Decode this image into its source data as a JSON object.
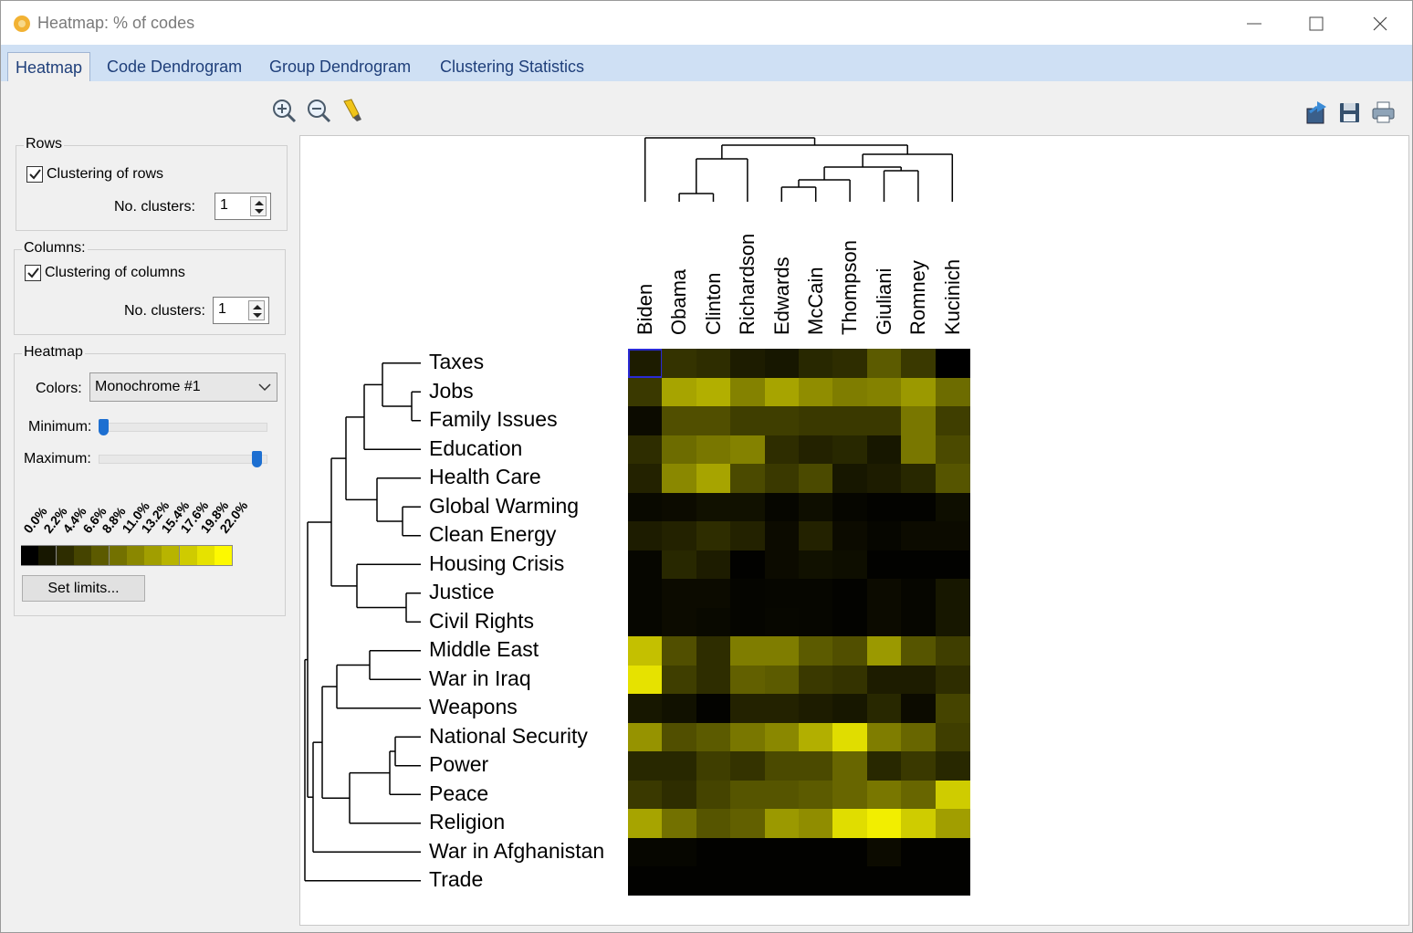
{
  "window": {
    "title": "Heatmap: % of codes",
    "icons": {
      "app": "app-logo-icon",
      "minimize": "minimize-icon",
      "maximize": "maximize-icon",
      "close": "close-icon"
    }
  },
  "tabs": [
    {
      "label": "Heatmap",
      "active": true
    },
    {
      "label": "Code Dendrogram",
      "active": false
    },
    {
      "label": "Group Dendrogram",
      "active": false
    },
    {
      "label": "Clustering Statistics",
      "active": false
    }
  ],
  "toolbar": {
    "left": [
      "zoom-in-icon",
      "zoom-out-icon",
      "highlighter-icon"
    ],
    "right": [
      "export-icon",
      "save-icon",
      "print-icon"
    ]
  },
  "rows_group": {
    "title": "Rows",
    "checkbox_label": "Clustering of rows",
    "checked": true,
    "clusters_label": "No. clusters:",
    "clusters_value": "1"
  },
  "columns_group": {
    "title": "Columns:",
    "checkbox_label": "Clustering of columns",
    "checked": true,
    "clusters_label": "No. clusters:",
    "clusters_value": "1"
  },
  "heatmap_group": {
    "title": "Heatmap",
    "colors_label": "Colors:",
    "colors_value": "Monochrome #1",
    "minimum_label": "Minimum:",
    "minimum_value": 0.0,
    "maximum_label": "Maximum:",
    "maximum_value": 1.0,
    "legend_labels": [
      "0.0%",
      "2.2%",
      "4.4%",
      "6.6%",
      "8.8%",
      "11.0%",
      "13.2%",
      "15.4%",
      "17.6%",
      "19.8%",
      "22.0%"
    ],
    "legend_colors": [
      "#000000",
      "#171700",
      "#2e2d00",
      "#454400",
      "#5c5a00",
      "#737100",
      "#8a8700",
      "#a19e00",
      "#b8b400",
      "#cfcb00",
      "#e6e200",
      "#fdf900"
    ],
    "set_limits_label": "Set limits..."
  },
  "chart_data": {
    "type": "heatmap",
    "columns": [
      "Biden",
      "Obama",
      "Clinton",
      "Richardson",
      "Edwards",
      "McCain",
      "Thompson",
      "Giuliani",
      "Romney",
      "Kucinich"
    ],
    "rows": [
      "Taxes",
      "Jobs",
      "Family Issues",
      "Education",
      "Health Care",
      "Global Warming",
      "Clean Energy",
      "Housing Crisis",
      "Justice",
      "Civil Rights",
      "Middle East",
      "War in Iraq",
      "Weapons",
      "National Security",
      "Power",
      "Peace",
      "Religion",
      "War in Afghanistan",
      "Trade"
    ],
    "scale_min_pct": 0.0,
    "scale_max_pct": 22.0,
    "values_pct": [
      [
        2.5,
        4.5,
        4.0,
        2.5,
        2.0,
        3.5,
        4.0,
        8.0,
        5.0,
        0.0
      ],
      [
        5.0,
        14.5,
        15.5,
        11.5,
        14.5,
        12.5,
        11.0,
        11.5,
        13.5,
        9.5
      ],
      [
        1.0,
        7.0,
        7.0,
        5.5,
        5.5,
        5.0,
        5.0,
        5.0,
        10.5,
        5.5
      ],
      [
        4.0,
        9.5,
        10.5,
        11.5,
        4.0,
        3.0,
        3.5,
        2.0,
        10.5,
        6.5
      ],
      [
        3.0,
        12.0,
        14.5,
        6.5,
        5.0,
        6.5,
        2.0,
        2.5,
        3.5,
        7.5
      ],
      [
        0.8,
        1.0,
        1.5,
        1.5,
        0.5,
        1.2,
        0.5,
        0.3,
        0.3,
        1.2
      ],
      [
        2.5,
        3.0,
        4.0,
        3.0,
        1.0,
        3.0,
        1.0,
        0.5,
        1.0,
        1.0
      ],
      [
        0.5,
        3.5,
        2.5,
        0.2,
        1.0,
        1.5,
        1.2,
        0.2,
        0.2,
        0.2
      ],
      [
        0.5,
        1.0,
        1.0,
        0.4,
        0.5,
        0.5,
        0.3,
        1.0,
        0.5,
        2.0
      ],
      [
        0.5,
        1.0,
        0.8,
        0.4,
        0.6,
        0.5,
        0.3,
        1.0,
        0.5,
        2.0
      ],
      [
        17.0,
        7.0,
        4.0,
        11.0,
        11.0,
        8.0,
        7.0,
        13.5,
        7.5,
        5.5
      ],
      [
        20.0,
        5.5,
        4.0,
        8.5,
        8.0,
        5.0,
        4.5,
        2.5,
        2.5,
        4.0
      ],
      [
        2.0,
        1.5,
        0.3,
        3.0,
        3.0,
        2.5,
        2.0,
        3.5,
        1.0,
        6.0
      ],
      [
        13.0,
        7.0,
        8.0,
        10.5,
        12.0,
        15.5,
        19.5,
        11.0,
        9.0,
        5.5
      ],
      [
        3.5,
        3.5,
        5.5,
        4.5,
        6.5,
        6.5,
        9.0,
        3.5,
        5.0,
        3.5
      ],
      [
        5.0,
        4.0,
        6.0,
        7.5,
        7.5,
        8.0,
        9.0,
        10.5,
        9.0,
        18.0
      ],
      [
        14.5,
        10.0,
        7.5,
        8.5,
        13.5,
        12.5,
        19.5,
        21.0,
        18.0,
        14.0
      ],
      [
        0.5,
        0.5,
        0.2,
        0.2,
        0.2,
        0.2,
        0.2,
        1.0,
        0.2,
        0.2
      ],
      [
        0.2,
        0.2,
        0.2,
        0.2,
        0.2,
        0.2,
        0.2,
        0.2,
        0.2,
        0.2
      ]
    ],
    "selected_cell": {
      "row": "Taxes",
      "column": "Biden"
    }
  }
}
